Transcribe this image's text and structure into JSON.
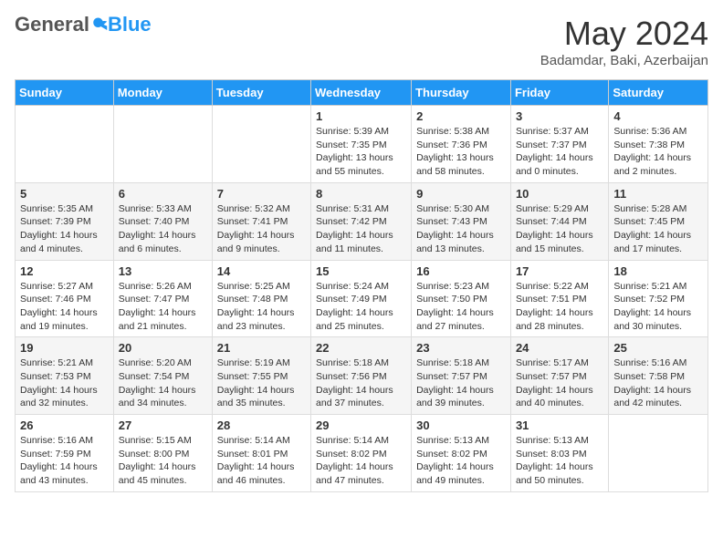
{
  "header": {
    "logo_general": "General",
    "logo_blue": "Blue",
    "month_title": "May 2024",
    "location": "Badamdar, Baki, Azerbaijan"
  },
  "days_of_week": [
    "Sunday",
    "Monday",
    "Tuesday",
    "Wednesday",
    "Thursday",
    "Friday",
    "Saturday"
  ],
  "weeks": [
    [
      {
        "day": "",
        "info": ""
      },
      {
        "day": "",
        "info": ""
      },
      {
        "day": "",
        "info": ""
      },
      {
        "day": "1",
        "info": "Sunrise: 5:39 AM\nSunset: 7:35 PM\nDaylight: 13 hours and 55 minutes."
      },
      {
        "day": "2",
        "info": "Sunrise: 5:38 AM\nSunset: 7:36 PM\nDaylight: 13 hours and 58 minutes."
      },
      {
        "day": "3",
        "info": "Sunrise: 5:37 AM\nSunset: 7:37 PM\nDaylight: 14 hours and 0 minutes."
      },
      {
        "day": "4",
        "info": "Sunrise: 5:36 AM\nSunset: 7:38 PM\nDaylight: 14 hours and 2 minutes."
      }
    ],
    [
      {
        "day": "5",
        "info": "Sunrise: 5:35 AM\nSunset: 7:39 PM\nDaylight: 14 hours and 4 minutes."
      },
      {
        "day": "6",
        "info": "Sunrise: 5:33 AM\nSunset: 7:40 PM\nDaylight: 14 hours and 6 minutes."
      },
      {
        "day": "7",
        "info": "Sunrise: 5:32 AM\nSunset: 7:41 PM\nDaylight: 14 hours and 9 minutes."
      },
      {
        "day": "8",
        "info": "Sunrise: 5:31 AM\nSunset: 7:42 PM\nDaylight: 14 hours and 11 minutes."
      },
      {
        "day": "9",
        "info": "Sunrise: 5:30 AM\nSunset: 7:43 PM\nDaylight: 14 hours and 13 minutes."
      },
      {
        "day": "10",
        "info": "Sunrise: 5:29 AM\nSunset: 7:44 PM\nDaylight: 14 hours and 15 minutes."
      },
      {
        "day": "11",
        "info": "Sunrise: 5:28 AM\nSunset: 7:45 PM\nDaylight: 14 hours and 17 minutes."
      }
    ],
    [
      {
        "day": "12",
        "info": "Sunrise: 5:27 AM\nSunset: 7:46 PM\nDaylight: 14 hours and 19 minutes."
      },
      {
        "day": "13",
        "info": "Sunrise: 5:26 AM\nSunset: 7:47 PM\nDaylight: 14 hours and 21 minutes."
      },
      {
        "day": "14",
        "info": "Sunrise: 5:25 AM\nSunset: 7:48 PM\nDaylight: 14 hours and 23 minutes."
      },
      {
        "day": "15",
        "info": "Sunrise: 5:24 AM\nSunset: 7:49 PM\nDaylight: 14 hours and 25 minutes."
      },
      {
        "day": "16",
        "info": "Sunrise: 5:23 AM\nSunset: 7:50 PM\nDaylight: 14 hours and 27 minutes."
      },
      {
        "day": "17",
        "info": "Sunrise: 5:22 AM\nSunset: 7:51 PM\nDaylight: 14 hours and 28 minutes."
      },
      {
        "day": "18",
        "info": "Sunrise: 5:21 AM\nSunset: 7:52 PM\nDaylight: 14 hours and 30 minutes."
      }
    ],
    [
      {
        "day": "19",
        "info": "Sunrise: 5:21 AM\nSunset: 7:53 PM\nDaylight: 14 hours and 32 minutes."
      },
      {
        "day": "20",
        "info": "Sunrise: 5:20 AM\nSunset: 7:54 PM\nDaylight: 14 hours and 34 minutes."
      },
      {
        "day": "21",
        "info": "Sunrise: 5:19 AM\nSunset: 7:55 PM\nDaylight: 14 hours and 35 minutes."
      },
      {
        "day": "22",
        "info": "Sunrise: 5:18 AM\nSunset: 7:56 PM\nDaylight: 14 hours and 37 minutes."
      },
      {
        "day": "23",
        "info": "Sunrise: 5:18 AM\nSunset: 7:57 PM\nDaylight: 14 hours and 39 minutes."
      },
      {
        "day": "24",
        "info": "Sunrise: 5:17 AM\nSunset: 7:57 PM\nDaylight: 14 hours and 40 minutes."
      },
      {
        "day": "25",
        "info": "Sunrise: 5:16 AM\nSunset: 7:58 PM\nDaylight: 14 hours and 42 minutes."
      }
    ],
    [
      {
        "day": "26",
        "info": "Sunrise: 5:16 AM\nSunset: 7:59 PM\nDaylight: 14 hours and 43 minutes."
      },
      {
        "day": "27",
        "info": "Sunrise: 5:15 AM\nSunset: 8:00 PM\nDaylight: 14 hours and 45 minutes."
      },
      {
        "day": "28",
        "info": "Sunrise: 5:14 AM\nSunset: 8:01 PM\nDaylight: 14 hours and 46 minutes."
      },
      {
        "day": "29",
        "info": "Sunrise: 5:14 AM\nSunset: 8:02 PM\nDaylight: 14 hours and 47 minutes."
      },
      {
        "day": "30",
        "info": "Sunrise: 5:13 AM\nSunset: 8:02 PM\nDaylight: 14 hours and 49 minutes."
      },
      {
        "day": "31",
        "info": "Sunrise: 5:13 AM\nSunset: 8:03 PM\nDaylight: 14 hours and 50 minutes."
      },
      {
        "day": "",
        "info": ""
      }
    ]
  ]
}
